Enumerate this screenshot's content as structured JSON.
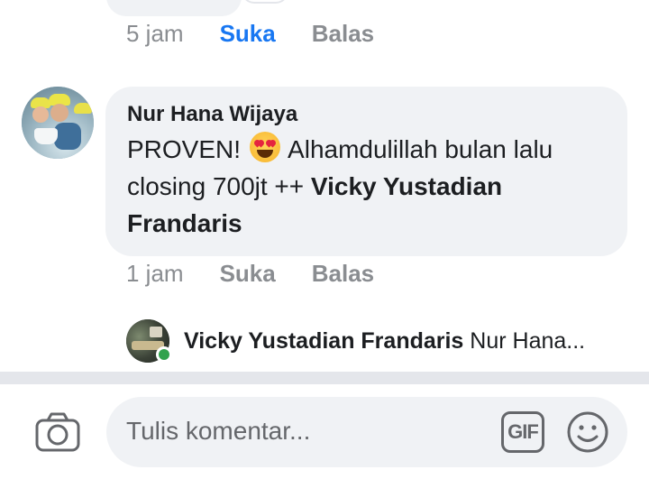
{
  "previous_comment": {
    "time": "5 jam",
    "like_label": "Suka",
    "reply_label": "Balas"
  },
  "comment": {
    "author": "Nur Hana Wijaya",
    "text_before_emoji": "PROVEN!",
    "emoji": "heart-eyes-emoji",
    "text_after_emoji": " Alhamdulillah bulan lalu closing 700jt ++ ",
    "mention": "Vicky Yustadian Frandaris",
    "time": "1 jam",
    "like_label": "Suka",
    "reply_label": "Balas"
  },
  "reply_preview": {
    "author": "Vicky Yustadian Frandaris",
    "preview": "Nur Hana..."
  },
  "composer": {
    "placeholder": "Tulis komentar...",
    "gif_label": "GIF",
    "camera_icon": "camera-icon",
    "emoji_icon": "smiley-icon"
  },
  "colors": {
    "accent": "#1877f2",
    "bubble": "#f0f2f5",
    "muted": "#8a8d91",
    "online": "#31a24c"
  }
}
